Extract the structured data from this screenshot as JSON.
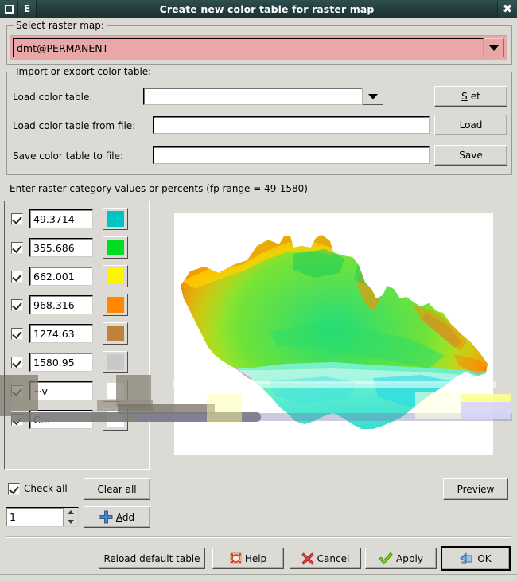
{
  "window": {
    "title": "Create new color table for raster map",
    "titlebar_buttons": [
      {
        "name": "restore-button",
        "glyph": "square"
      },
      {
        "name": "menu-button",
        "glyph": "E"
      }
    ],
    "close_label": "✖"
  },
  "select_raster": {
    "legend": "Select raster map:",
    "value": "dmt@PERMANENT",
    "background_color": "#e9a7a7"
  },
  "import_export": {
    "legend": "Import or export color table:",
    "rows": [
      {
        "label": "Load color table:",
        "value": "",
        "button": "Set",
        "mnemonic": "S",
        "has_combo": true
      },
      {
        "label": "Load color table from file:",
        "value": "",
        "button": "Load",
        "mnemonic": "",
        "has_combo": false
      },
      {
        "label": "Save color table to file:",
        "value": "",
        "button": "Save",
        "mnemonic": "",
        "has_combo": false
      }
    ]
  },
  "categories": {
    "heading": "Enter raster category values or percents (fp range = 49-1580)",
    "fp_range_min": 49,
    "fp_range_max": 1580,
    "rows": [
      {
        "checked": true,
        "value": "49.3714",
        "color": "#00c3c3"
      },
      {
        "checked": true,
        "value": "355.686",
        "color": "#00dd22"
      },
      {
        "checked": true,
        "value": "662.001",
        "color": "#fdf500"
      },
      {
        "checked": true,
        "value": "968.316",
        "color": "#ff8800"
      },
      {
        "checked": true,
        "value": "1274.63",
        "color": "#bd823c"
      },
      {
        "checked": true,
        "value": "1580.95",
        "color": "#c8c8c8"
      },
      {
        "checked": true,
        "value": "~v",
        "color": "#ffffff"
      },
      {
        "checked": true,
        "value": "C…",
        "color": "#ffffff"
      }
    ]
  },
  "list_controls": {
    "check_all_label": "Check all",
    "check_all_checked": true,
    "clear_all_label": "Clear all",
    "add_count": "1",
    "add_label": "Add",
    "add_mnemonic": "A",
    "add_icon": "plus-icon"
  },
  "preview": {
    "label": "Preview"
  },
  "map_preview": {
    "name": "raster-map-preview",
    "description": "Digital elevation model raster of the Czech Republic rendered with the current color table",
    "background_color": "#ffffff"
  },
  "footer": {
    "reload_label": "Reload default table",
    "buttons": [
      {
        "name": "help-button",
        "label": "Help",
        "mnemonic": "H",
        "icon": "help-icon",
        "default": false
      },
      {
        "name": "cancel-button",
        "label": "Cancel",
        "mnemonic": "C",
        "icon": "cancel-icon",
        "default": false
      },
      {
        "name": "apply-button",
        "label": "Apply",
        "mnemonic": "A",
        "icon": "apply-icon",
        "default": false
      },
      {
        "name": "ok-button",
        "label": "OK",
        "mnemonic": "O",
        "icon": "ok-icon",
        "default": true
      }
    ]
  }
}
